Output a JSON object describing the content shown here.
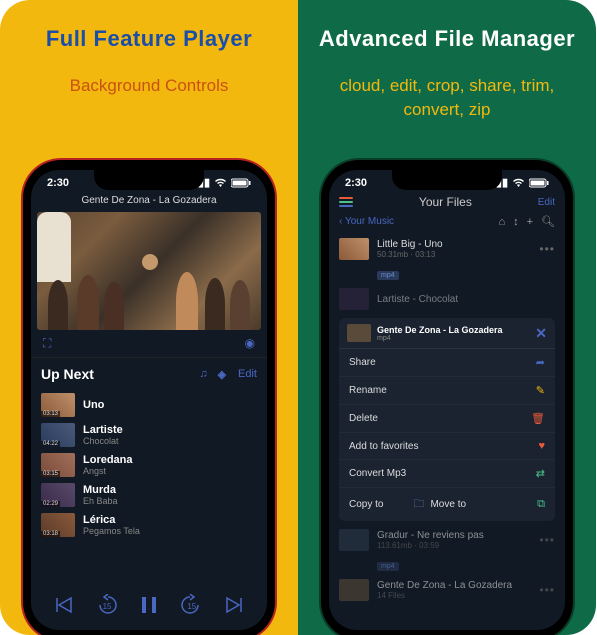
{
  "left": {
    "title": "Full Feature Player",
    "subtitle": "Background Controls",
    "status_time": "2:30",
    "now_playing": "Gente De Zona - La Gozadera",
    "up_next_label": "Up Next",
    "edit_label": "Edit",
    "skip_back_sec": "15",
    "skip_fwd_sec": "15",
    "queue": [
      {
        "time": "03:13",
        "title": "Uno",
        "artist": ""
      },
      {
        "time": "04:22",
        "title": "Lartiste",
        "artist": "Chocolat"
      },
      {
        "time": "03:15",
        "title": "Loredana",
        "artist": "Angst"
      },
      {
        "time": "02:29",
        "title": "Murda",
        "artist": "Eh Baba"
      },
      {
        "time": "03:18",
        "title": "Lérica",
        "artist": "Pegamos Tela"
      }
    ]
  },
  "right": {
    "title": "Advanced File Manager",
    "subtitle": "cloud, edit, crop, share, trim, convert, zip",
    "status_time": "2:30",
    "header": "Your Files",
    "edit_label": "Edit",
    "breadcrumb": "Your Music",
    "files": [
      {
        "title": "Little Big - Uno",
        "meta_size": "50.31mb",
        "meta_time": "03:13",
        "badge": "mp4"
      },
      {
        "title": "Lartiste - Chocolat",
        "meta_size": "",
        "meta_time": "",
        "badge": ""
      },
      {
        "title": "Gradur - Ne reviens pas",
        "meta_size": "113.61mb",
        "meta_time": "03:59",
        "badge": "mp4"
      },
      {
        "title": "Gente De Zona - La Gozadera",
        "meta_size": "",
        "meta_time": "",
        "badge": "",
        "sub": "14 Files"
      }
    ],
    "popup": {
      "title": "Gente De Zona - La Gozadera",
      "type": "mp4",
      "share": "Share",
      "rename": "Rename",
      "delete": "Delete",
      "fav": "Add to favorites",
      "convert": "Convert Mp3",
      "copy": "Copy to",
      "move": "Move to"
    }
  }
}
